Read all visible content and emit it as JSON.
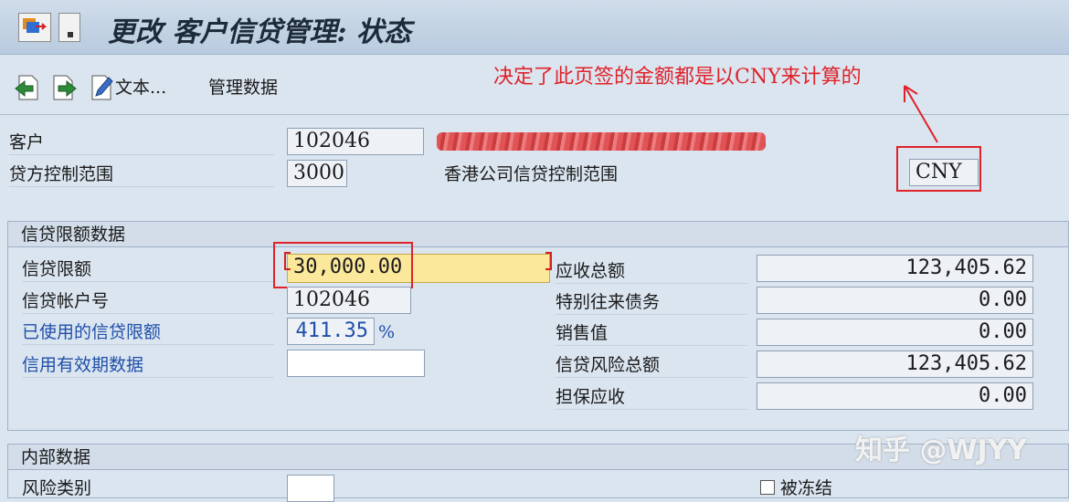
{
  "window": {
    "title": "更改 客户信贷管理: 状态"
  },
  "toolbar": {
    "text_button": "文本...",
    "admin_data_button": "管理数据"
  },
  "annotation": {
    "text": "决定了此页签的金额都是以CNY来计算的"
  },
  "header": {
    "customer_label": "客户",
    "customer_value": "102046",
    "credit_area_label": "贷方控制范围",
    "credit_area_value": "3000",
    "credit_area_desc": "香港公司信贷控制范围",
    "currency": "CNY"
  },
  "credit_limit_section": {
    "title": "信贷限额数据",
    "credit_limit_label": "信贷限额",
    "credit_limit_value": "30,000.00",
    "account_label": "信贷帐户号",
    "account_value": "102046",
    "used_label": "已使用的信贷限额",
    "used_value": "411.35",
    "used_unit": "%",
    "validity_label": "信用有效期数据",
    "validity_value": "",
    "receivables_label": "应收总额",
    "receivables_value": "123,405.62",
    "special_label": "特别往来债务",
    "special_value": "0.00",
    "sales_label": "销售值",
    "sales_value": "0.00",
    "exposure_label": "信贷风险总额",
    "exposure_value": "123,405.62",
    "secured_label": "担保应收",
    "secured_value": "0.00"
  },
  "internal_section": {
    "title": "内部数据",
    "risk_label": "风险类别",
    "blocked_label": "被冻结"
  },
  "watermark": "知乎 @WJYY",
  "colors": {
    "annotation_red": "#e0222a",
    "highlight_yellow": "#fbe89a",
    "link_blue": "#1f4fa8"
  }
}
